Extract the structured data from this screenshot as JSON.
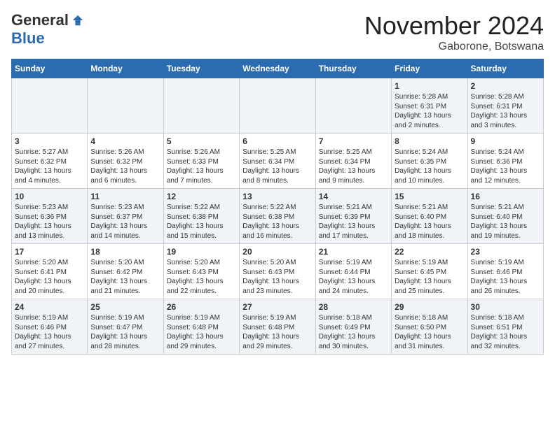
{
  "logo": {
    "general": "General",
    "blue": "Blue"
  },
  "title": "November 2024",
  "subtitle": "Gaborone, Botswana",
  "days_of_week": [
    "Sunday",
    "Monday",
    "Tuesday",
    "Wednesday",
    "Thursday",
    "Friday",
    "Saturday"
  ],
  "weeks": [
    [
      {
        "day": "",
        "detail": ""
      },
      {
        "day": "",
        "detail": ""
      },
      {
        "day": "",
        "detail": ""
      },
      {
        "day": "",
        "detail": ""
      },
      {
        "day": "",
        "detail": ""
      },
      {
        "day": "1",
        "detail": "Sunrise: 5:28 AM\nSunset: 6:31 PM\nDaylight: 13 hours and 2 minutes."
      },
      {
        "day": "2",
        "detail": "Sunrise: 5:28 AM\nSunset: 6:31 PM\nDaylight: 13 hours and 3 minutes."
      }
    ],
    [
      {
        "day": "3",
        "detail": "Sunrise: 5:27 AM\nSunset: 6:32 PM\nDaylight: 13 hours and 4 minutes."
      },
      {
        "day": "4",
        "detail": "Sunrise: 5:26 AM\nSunset: 6:32 PM\nDaylight: 13 hours and 6 minutes."
      },
      {
        "day": "5",
        "detail": "Sunrise: 5:26 AM\nSunset: 6:33 PM\nDaylight: 13 hours and 7 minutes."
      },
      {
        "day": "6",
        "detail": "Sunrise: 5:25 AM\nSunset: 6:34 PM\nDaylight: 13 hours and 8 minutes."
      },
      {
        "day": "7",
        "detail": "Sunrise: 5:25 AM\nSunset: 6:34 PM\nDaylight: 13 hours and 9 minutes."
      },
      {
        "day": "8",
        "detail": "Sunrise: 5:24 AM\nSunset: 6:35 PM\nDaylight: 13 hours and 10 minutes."
      },
      {
        "day": "9",
        "detail": "Sunrise: 5:24 AM\nSunset: 6:36 PM\nDaylight: 13 hours and 12 minutes."
      }
    ],
    [
      {
        "day": "10",
        "detail": "Sunrise: 5:23 AM\nSunset: 6:36 PM\nDaylight: 13 hours and 13 minutes."
      },
      {
        "day": "11",
        "detail": "Sunrise: 5:23 AM\nSunset: 6:37 PM\nDaylight: 13 hours and 14 minutes."
      },
      {
        "day": "12",
        "detail": "Sunrise: 5:22 AM\nSunset: 6:38 PM\nDaylight: 13 hours and 15 minutes."
      },
      {
        "day": "13",
        "detail": "Sunrise: 5:22 AM\nSunset: 6:38 PM\nDaylight: 13 hours and 16 minutes."
      },
      {
        "day": "14",
        "detail": "Sunrise: 5:21 AM\nSunset: 6:39 PM\nDaylight: 13 hours and 17 minutes."
      },
      {
        "day": "15",
        "detail": "Sunrise: 5:21 AM\nSunset: 6:40 PM\nDaylight: 13 hours and 18 minutes."
      },
      {
        "day": "16",
        "detail": "Sunrise: 5:21 AM\nSunset: 6:40 PM\nDaylight: 13 hours and 19 minutes."
      }
    ],
    [
      {
        "day": "17",
        "detail": "Sunrise: 5:20 AM\nSunset: 6:41 PM\nDaylight: 13 hours and 20 minutes."
      },
      {
        "day": "18",
        "detail": "Sunrise: 5:20 AM\nSunset: 6:42 PM\nDaylight: 13 hours and 21 minutes."
      },
      {
        "day": "19",
        "detail": "Sunrise: 5:20 AM\nSunset: 6:43 PM\nDaylight: 13 hours and 22 minutes."
      },
      {
        "day": "20",
        "detail": "Sunrise: 5:20 AM\nSunset: 6:43 PM\nDaylight: 13 hours and 23 minutes."
      },
      {
        "day": "21",
        "detail": "Sunrise: 5:19 AM\nSunset: 6:44 PM\nDaylight: 13 hours and 24 minutes."
      },
      {
        "day": "22",
        "detail": "Sunrise: 5:19 AM\nSunset: 6:45 PM\nDaylight: 13 hours and 25 minutes."
      },
      {
        "day": "23",
        "detail": "Sunrise: 5:19 AM\nSunset: 6:46 PM\nDaylight: 13 hours and 26 minutes."
      }
    ],
    [
      {
        "day": "24",
        "detail": "Sunrise: 5:19 AM\nSunset: 6:46 PM\nDaylight: 13 hours and 27 minutes."
      },
      {
        "day": "25",
        "detail": "Sunrise: 5:19 AM\nSunset: 6:47 PM\nDaylight: 13 hours and 28 minutes."
      },
      {
        "day": "26",
        "detail": "Sunrise: 5:19 AM\nSunset: 6:48 PM\nDaylight: 13 hours and 29 minutes."
      },
      {
        "day": "27",
        "detail": "Sunrise: 5:19 AM\nSunset: 6:48 PM\nDaylight: 13 hours and 29 minutes."
      },
      {
        "day": "28",
        "detail": "Sunrise: 5:18 AM\nSunset: 6:49 PM\nDaylight: 13 hours and 30 minutes."
      },
      {
        "day": "29",
        "detail": "Sunrise: 5:18 AM\nSunset: 6:50 PM\nDaylight: 13 hours and 31 minutes."
      },
      {
        "day": "30",
        "detail": "Sunrise: 5:18 AM\nSunset: 6:51 PM\nDaylight: 13 hours and 32 minutes."
      }
    ]
  ]
}
